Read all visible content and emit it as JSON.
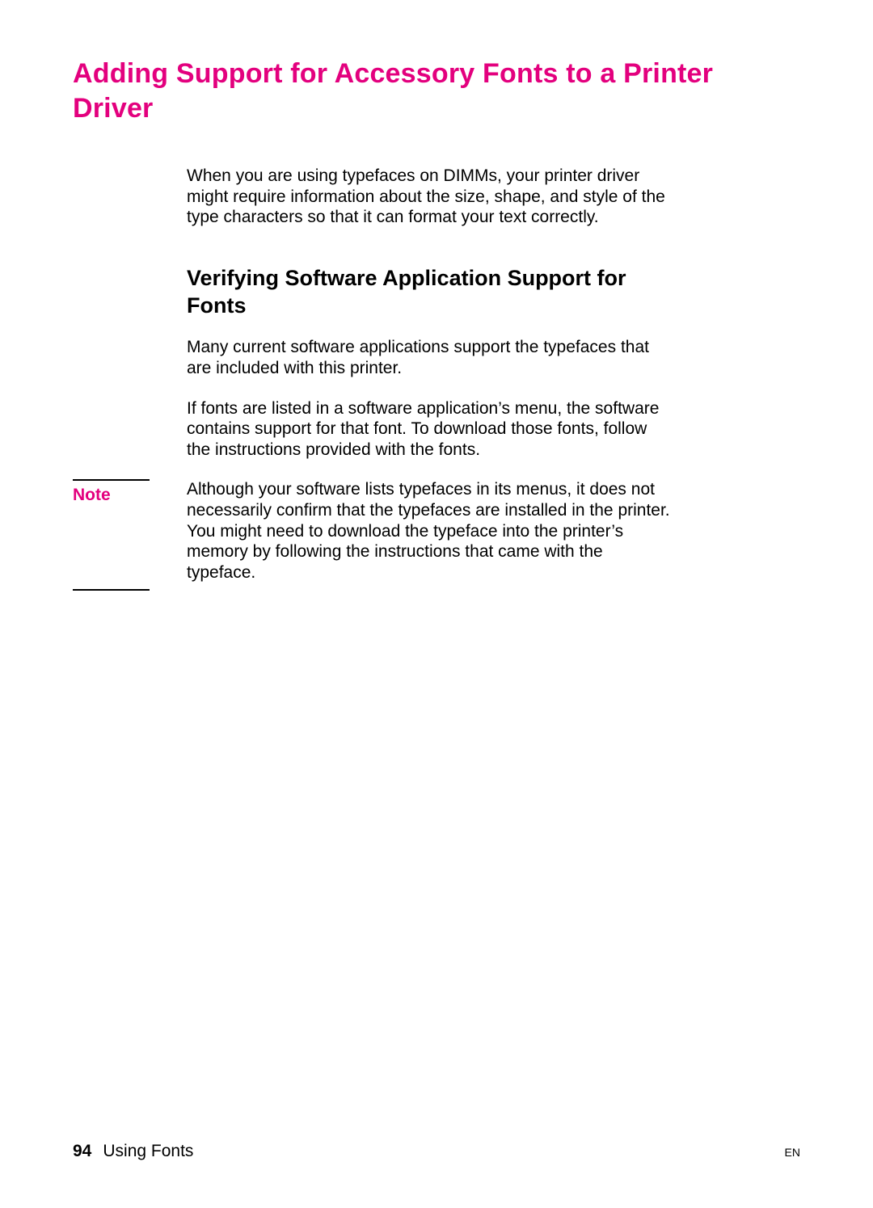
{
  "heading": "Adding Support for Accessory Fonts to a Printer Driver",
  "intro": "When you are using typefaces on DIMMs, your printer driver might require information about the size, shape, and style of the type characters so that it can format your text correctly.",
  "subheading": "Verifying Software Application Support for Fonts",
  "para2": "Many current software applications support the typefaces that are included with this printer.",
  "para3": "If fonts are listed in a software application’s menu, the software contains support for that font. To download those fonts, follow the instructions provided with the fonts.",
  "note": {
    "label": "Note",
    "text": "Although your software lists typefaces in its menus, it does not necessarily confirm that the typefaces are installed in the printer. You might need to download the typeface into the printer’s memory by following the instructions that came with the typeface."
  },
  "footer": {
    "page_number": "94",
    "section": "Using Fonts",
    "lang": "EN"
  }
}
